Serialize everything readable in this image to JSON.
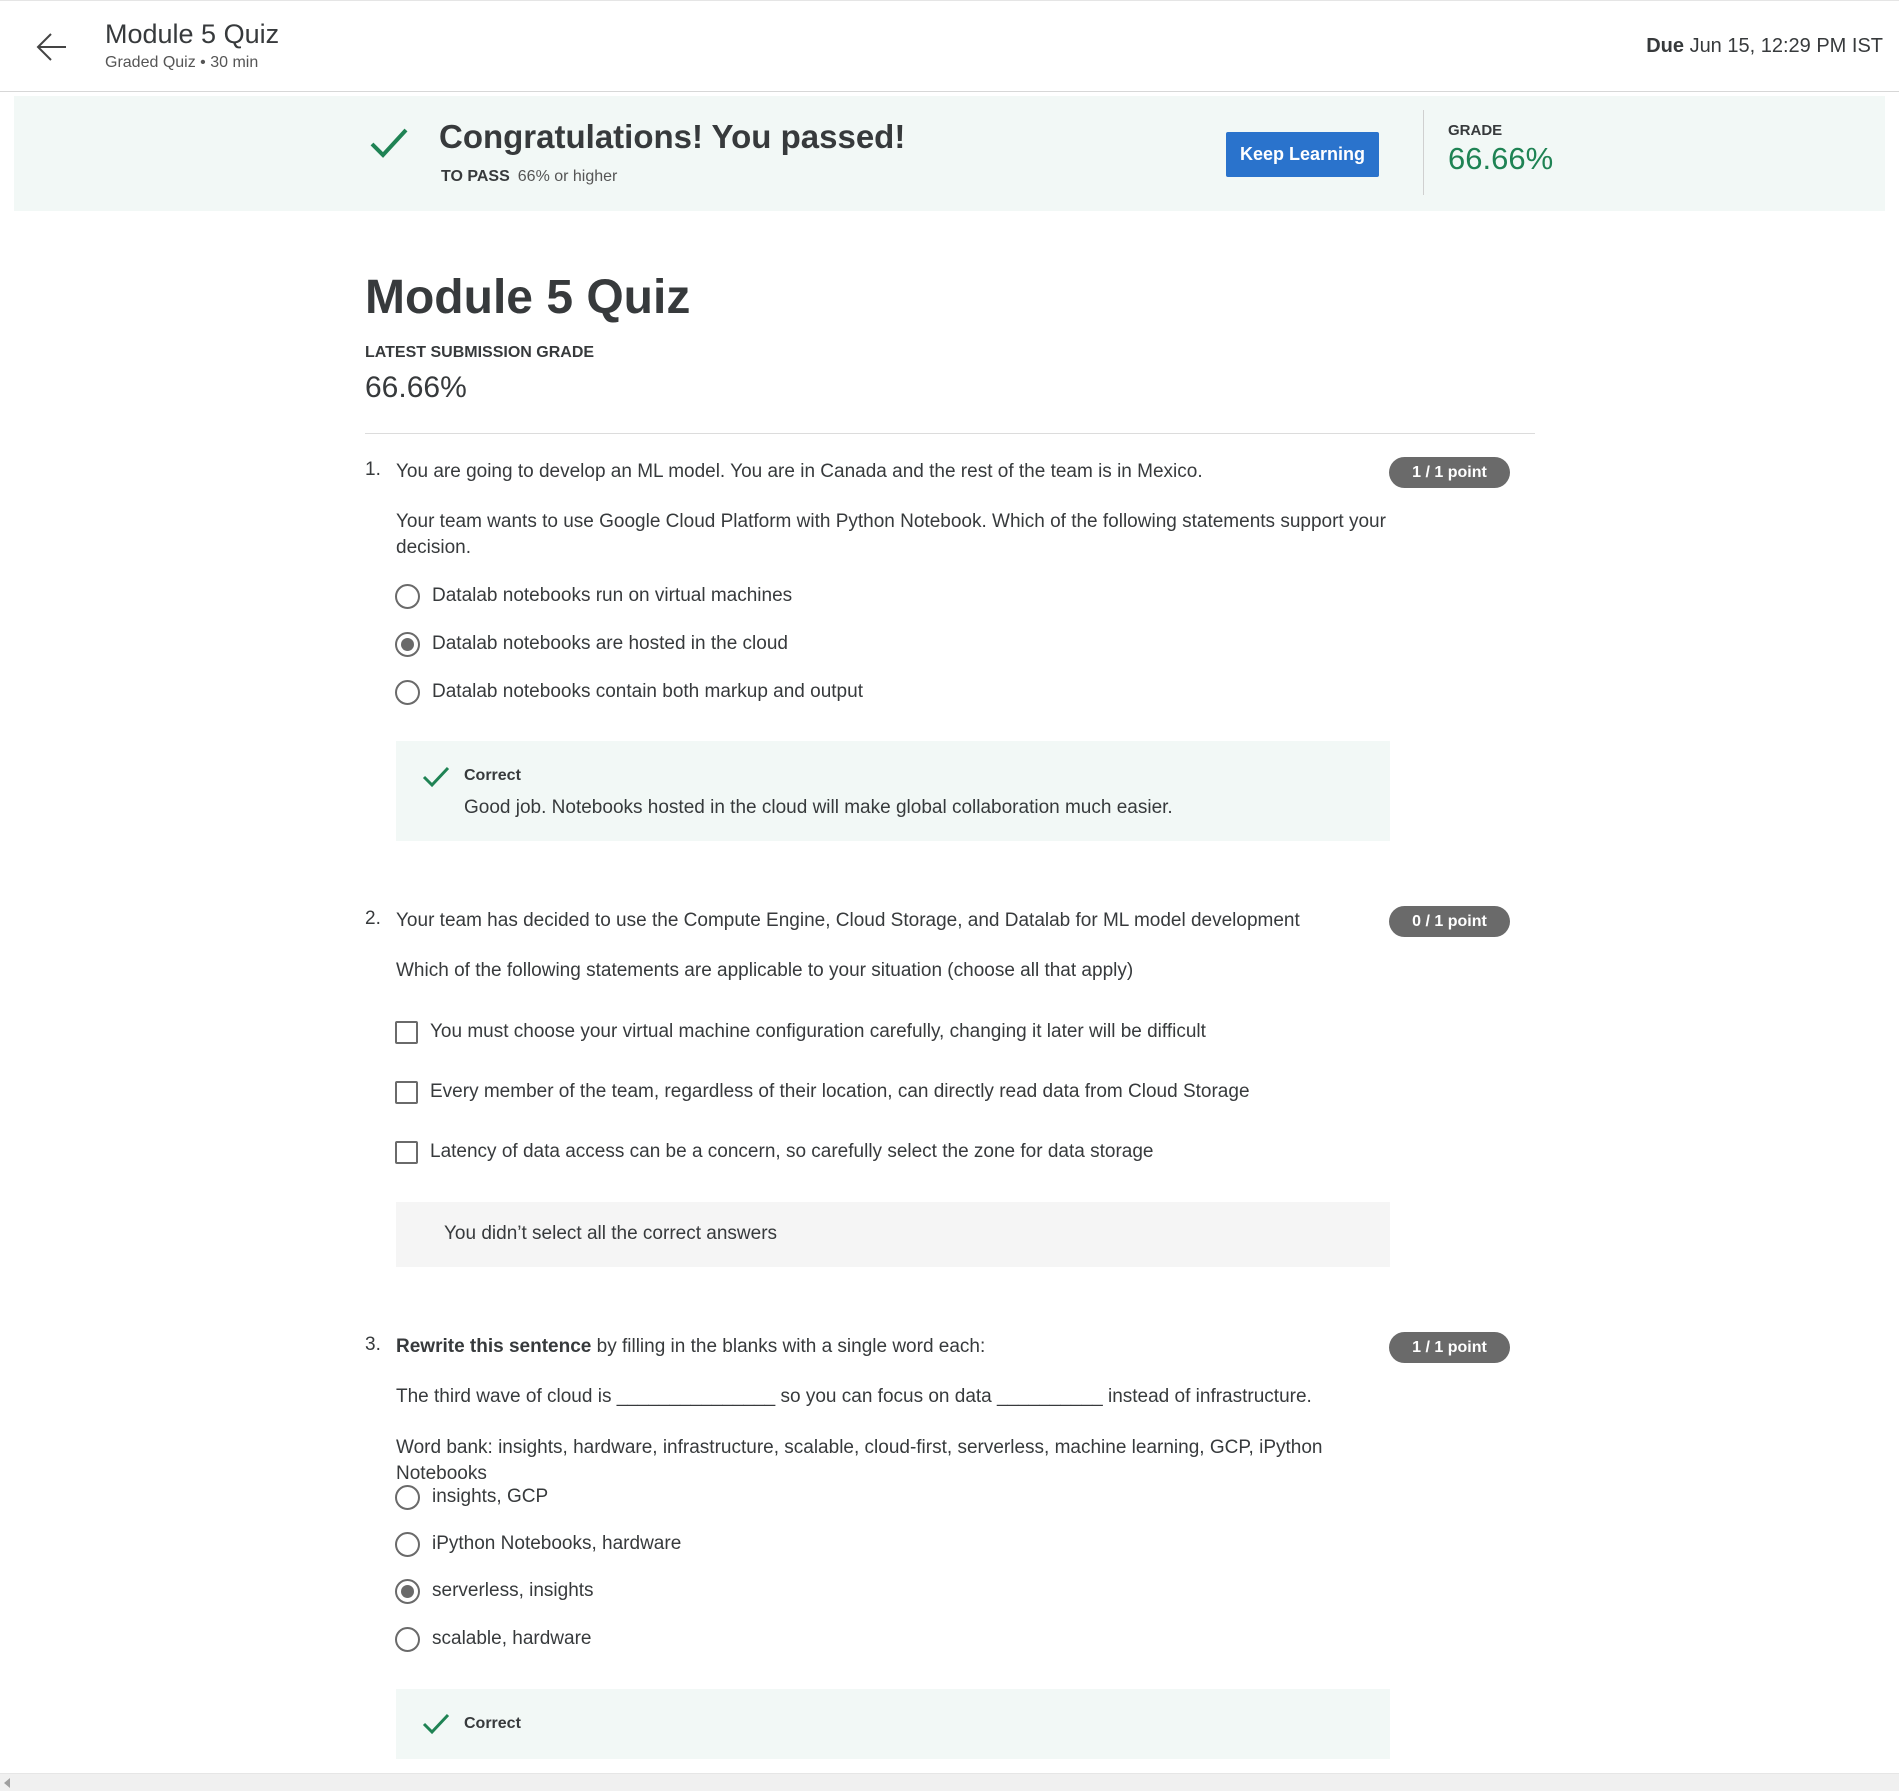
{
  "header": {
    "title": "Module 5 Quiz",
    "subtitle": "Graded Quiz • 30 min",
    "due_label": "Due",
    "due_value": "Jun 15, 12:29 PM IST"
  },
  "banner": {
    "title": "Congratulations! You passed!",
    "to_pass_label": "TO PASS",
    "to_pass_value": "66% or higher",
    "keep_learning_label": "Keep Learning",
    "grade_label": "GRADE",
    "grade_value": "66.66%"
  },
  "main": {
    "title": "Module 5 Quiz",
    "latest_grade_label": "LATEST SUBMISSION GRADE",
    "latest_grade_value": "66.66%"
  },
  "questions": [
    {
      "number": "1.",
      "text": "You are going to develop an ML model. You are in Canada and the rest of the team is in Mexico.",
      "text2": "Your team wants to use Google Cloud Platform with Python Notebook. Which of the following statements support your decision.",
      "points": "1 / 1 point",
      "type": "radio",
      "options": [
        {
          "label": "Datalab notebooks run on virtual machines",
          "selected": false
        },
        {
          "label": "Datalab notebooks are hosted in the cloud",
          "selected": true
        },
        {
          "label": "Datalab notebooks contain both markup and output",
          "selected": false
        }
      ],
      "feedback": {
        "status": "Correct",
        "text": "Good job. Notebooks hosted in the cloud will make global collaboration much easier."
      }
    },
    {
      "number": "2.",
      "text": "Your team has decided to use the Compute Engine, Cloud Storage, and Datalab for ML model development",
      "text2": "Which of the following statements are applicable to your situation (choose all that apply)",
      "points": "0 / 1 point",
      "type": "checkbox",
      "options": [
        {
          "label": "You must choose your virtual machine configuration carefully, changing it later will be difficult",
          "selected": false
        },
        {
          "label": "Every member of the team, regardless of their location, can directly read data from Cloud Storage",
          "selected": false
        },
        {
          "label": "Latency of data access can be a concern, so carefully select the zone for data storage",
          "selected": false
        }
      ],
      "feedback": {
        "text": "You didn’t select all the correct answers"
      }
    },
    {
      "number": "3.",
      "text_bold": "Rewrite this sentence",
      "text": " by filling in the blanks with a single word each:",
      "text2": "The third wave of cloud is _______________ so you can focus on data __________ instead of infrastructure.",
      "text3": "Word bank: insights, hardware, infrastructure, scalable, cloud-first, serverless, machine learning, GCP, iPython Notebooks",
      "points": "1 / 1 point",
      "type": "radio",
      "options": [
        {
          "label": "insights, GCP",
          "selected": false
        },
        {
          "label": "iPython Notebooks, hardware",
          "selected": false
        },
        {
          "label": "serverless, insights",
          "selected": true
        },
        {
          "label": "scalable, hardware",
          "selected": false
        }
      ],
      "feedback": {
        "status": "Correct"
      }
    }
  ],
  "colors": {
    "accent_blue": "#2a73cc",
    "success_green": "#1f8354",
    "banner_bg": "#f2f8f6",
    "pill_gray": "#6a6a6a"
  },
  "icons": [
    "back-arrow-icon",
    "checkmark-icon",
    "scroll-left-icon"
  ]
}
